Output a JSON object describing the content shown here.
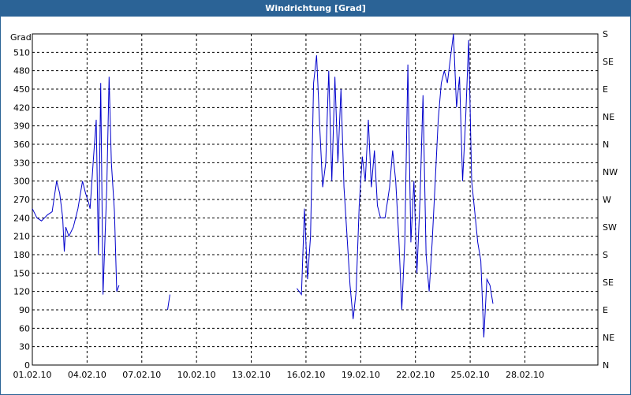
{
  "window": {
    "title": "Windrichtung [Grad]"
  },
  "chart_data": {
    "type": "line",
    "title": "Windrichtung [Grad]",
    "ylabel": "Grad",
    "ylim": [
      0,
      540
    ],
    "xlim": [
      "01.02.10",
      "04.03.10"
    ],
    "y_ticks": [
      0,
      30,
      60,
      90,
      120,
      150,
      180,
      210,
      240,
      270,
      300,
      330,
      360,
      390,
      420,
      450,
      480,
      510
    ],
    "x_ticks": [
      "01.02.10",
      "04.02.10",
      "07.02.10",
      "10.02.10",
      "13.02.10",
      "16.02.10",
      "19.02.10",
      "22.02.10",
      "25.02.10",
      "28.02.10"
    ],
    "right_axis_labels": [
      "N",
      "NE",
      "E",
      "SE",
      "S",
      "SW",
      "W",
      "NW",
      "N",
      "NE",
      "E",
      "SE",
      "S"
    ],
    "grid": true,
    "line_color": "#0000cc",
    "series": [
      {
        "segments": [
          [
            [
              "2010-02-01T00:00",
              255
            ],
            [
              "2010-02-01T06:00",
              240
            ],
            [
              "2010-02-01T12:00",
              235
            ],
            [
              "2010-02-01T20:00",
              245
            ],
            [
              "2010-02-02T02:00",
              250
            ],
            [
              "2010-02-02T08:00",
              300
            ],
            [
              "2010-02-02T12:00",
              280
            ],
            [
              "2010-02-02T16:00",
              240
            ],
            [
              "2010-02-02T18:00",
              185
            ],
            [
              "2010-02-02T20:00",
              225
            ],
            [
              "2010-02-03T00:00",
              210
            ],
            [
              "2010-02-03T06:00",
              225
            ],
            [
              "2010-02-03T12:00",
              255
            ],
            [
              "2010-02-03T18:00",
              300
            ],
            [
              "2010-02-03T22:00",
              280
            ],
            [
              "2010-02-04T02:00",
              265
            ],
            [
              "2010-02-04T04:00",
              255
            ],
            [
              "2010-02-04T08:00",
              330
            ],
            [
              "2010-02-04T12:00",
              400
            ],
            [
              "2010-02-04T15:00",
              180
            ],
            [
              "2010-02-04T18:00",
              460
            ],
            [
              "2010-02-04T21:00",
              115
            ],
            [
              "2010-02-05T02:00",
              290
            ],
            [
              "2010-02-05T05:00",
              470
            ],
            [
              "2010-02-05T08:00",
              330
            ],
            [
              "2010-02-05T12:00",
              250
            ],
            [
              "2010-02-05T15:00",
              120
            ],
            [
              "2010-02-05T18:00",
              130
            ]
          ],
          [
            [
              "2010-02-08T10:00",
              90
            ],
            [
              "2010-02-08T13:00",
              115
            ]
          ],
          [
            [
              "2010-02-15T12:00",
              125
            ],
            [
              "2010-02-15T18:00",
              115
            ],
            [
              "2010-02-15T22:00",
              255
            ],
            [
              "2010-02-16T02:00",
              140
            ],
            [
              "2010-02-16T06:00",
              210
            ],
            [
              "2010-02-16T10:00",
              460
            ],
            [
              "2010-02-16T14:00",
              505
            ],
            [
              "2010-02-16T18:00",
              390
            ],
            [
              "2010-02-16T22:00",
              290
            ],
            [
              "2010-02-17T02:00",
              330
            ],
            [
              "2010-02-17T06:00",
              480
            ],
            [
              "2010-02-17T10:00",
              300
            ],
            [
              "2010-02-17T14:00",
              470
            ],
            [
              "2010-02-17T18:00",
              330
            ],
            [
              "2010-02-17T22:00",
              450
            ],
            [
              "2010-02-18T02:00",
              290
            ],
            [
              "2010-02-18T06:00",
              210
            ],
            [
              "2010-02-18T10:00",
              130
            ],
            [
              "2010-02-18T14:00",
              75
            ],
            [
              "2010-02-18T18:00",
              120
            ],
            [
              "2010-02-18T22:00",
              260
            ],
            [
              "2010-02-19T02:00",
              340
            ],
            [
              "2010-02-19T06:00",
              300
            ],
            [
              "2010-02-19T10:00",
              400
            ],
            [
              "2010-02-19T14:00",
              290
            ],
            [
              "2010-02-19T18:00",
              350
            ],
            [
              "2010-02-19T22:00",
              260
            ],
            [
              "2010-02-20T02:00",
              240
            ],
            [
              "2010-02-20T08:00",
              240
            ],
            [
              "2010-02-20T14:00",
              290
            ],
            [
              "2010-02-20T18:00",
              350
            ],
            [
              "2010-02-20T22:00",
              300
            ],
            [
              "2010-02-21T02:00",
              210
            ],
            [
              "2010-02-21T06:00",
              90
            ],
            [
              "2010-02-21T10:00",
              200
            ],
            [
              "2010-02-21T14:00",
              490
            ],
            [
              "2010-02-21T18:00",
              200
            ],
            [
              "2010-02-21T22:00",
              300
            ],
            [
              "2010-02-22T02:00",
              150
            ],
            [
              "2010-02-22T06:00",
              270
            ],
            [
              "2010-02-22T10:00",
              440
            ],
            [
              "2010-02-22T14:00",
              180
            ],
            [
              "2010-02-22T18:00",
              120
            ],
            [
              "2010-02-22T22:00",
              200
            ],
            [
              "2010-02-23T02:00",
              300
            ],
            [
              "2010-02-23T06:00",
              400
            ],
            [
              "2010-02-23T10:00",
              460
            ],
            [
              "2010-02-23T14:00",
              480
            ],
            [
              "2010-02-23T18:00",
              460
            ],
            [
              "2010-02-23T22:00",
              500
            ],
            [
              "2010-02-24T02:00",
              540
            ],
            [
              "2010-02-24T06:00",
              420
            ],
            [
              "2010-02-24T10:00",
              470
            ],
            [
              "2010-02-24T14:00",
              300
            ],
            [
              "2010-02-24T18:00",
              400
            ],
            [
              "2010-02-24T22:00",
              530
            ],
            [
              "2010-02-25T02:00",
              300
            ],
            [
              "2010-02-25T06:00",
              250
            ],
            [
              "2010-02-25T10:00",
              200
            ],
            [
              "2010-02-25T14:00",
              170
            ],
            [
              "2010-02-25T18:00",
              45
            ],
            [
              "2010-02-25T22:00",
              140
            ],
            [
              "2010-02-26T02:00",
              130
            ],
            [
              "2010-02-26T06:00",
              100
            ]
          ]
        ]
      }
    ]
  }
}
